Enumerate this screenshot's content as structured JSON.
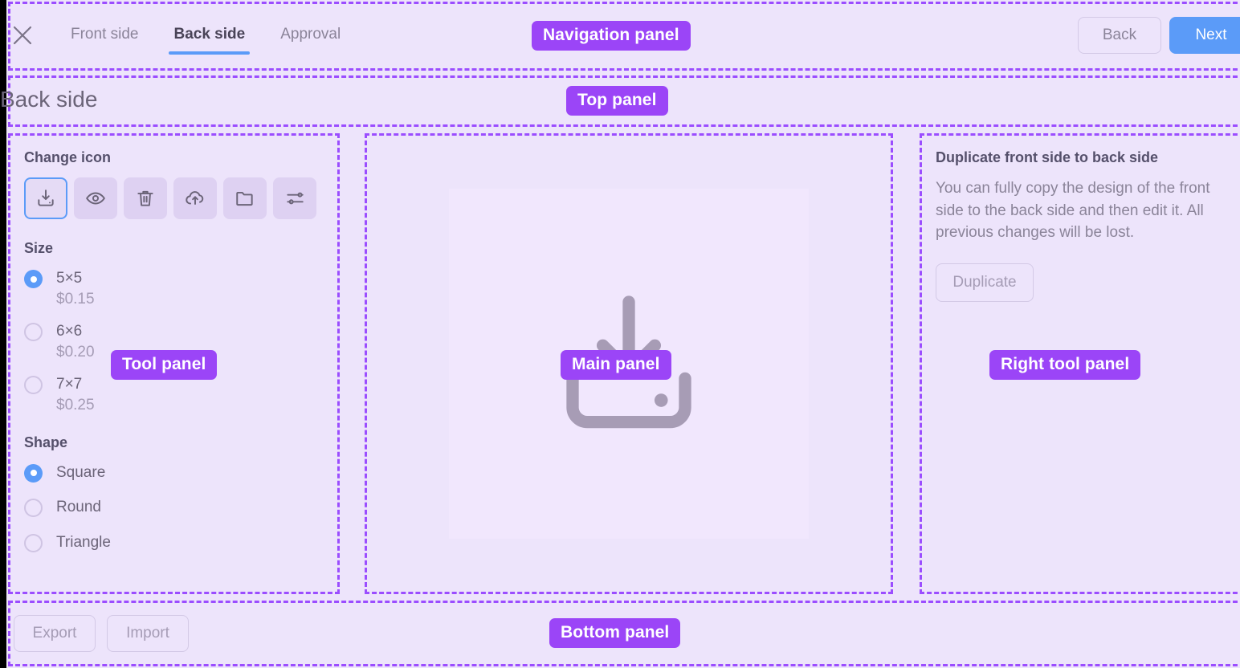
{
  "nav": {
    "close_icon": "close-icon",
    "tabs": [
      {
        "label": "Front side",
        "active": false
      },
      {
        "label": "Back side",
        "active": true
      },
      {
        "label": "Approval",
        "active": false
      }
    ],
    "back_label": "Back",
    "next_label": "Next"
  },
  "top": {
    "title": "Back side"
  },
  "tool": {
    "change_icon_label": "Change icon",
    "icons": [
      {
        "name": "download-icon",
        "selected": true
      },
      {
        "name": "eye-icon",
        "selected": false
      },
      {
        "name": "trash-icon",
        "selected": false
      },
      {
        "name": "cloud-upload-icon",
        "selected": false
      },
      {
        "name": "folder-icon",
        "selected": false
      },
      {
        "name": "sliders-icon",
        "selected": false
      }
    ],
    "size_label": "Size",
    "sizes": [
      {
        "label": "5×5",
        "price": "$0.15",
        "selected": true
      },
      {
        "label": "6×6",
        "price": "$0.20",
        "selected": false
      },
      {
        "label": "7×7",
        "price": "$0.25",
        "selected": false
      }
    ],
    "shape_label": "Shape",
    "shapes": [
      {
        "label": "Square",
        "selected": true
      },
      {
        "label": "Round",
        "selected": false
      },
      {
        "label": "Triangle",
        "selected": false
      }
    ]
  },
  "main": {
    "preview_icon": "download-icon"
  },
  "right": {
    "title": "Duplicate front side to back side",
    "body": "You can fully copy the design of the front side to the back side and then edit it. All previous changes will be lost.",
    "duplicate_label": "Duplicate"
  },
  "bottom": {
    "export_label": "Export",
    "import_label": "Import"
  },
  "annotations": {
    "navigation": "Navigation panel",
    "top": "Top panel",
    "tool": "Tool panel",
    "main": "Main panel",
    "right": "Right tool panel",
    "bottom": "Bottom panel"
  },
  "colors": {
    "page_background": "#ede4fb",
    "canvas_background": "#f1e7fd",
    "annotation_purple": "#9b45f7",
    "region_border": "#9b4dff",
    "accent_blue": "#5b9bf8",
    "icon_button_background": "#ded1f2",
    "text_muted": "#8b8499",
    "text_strong": "#55506b"
  }
}
